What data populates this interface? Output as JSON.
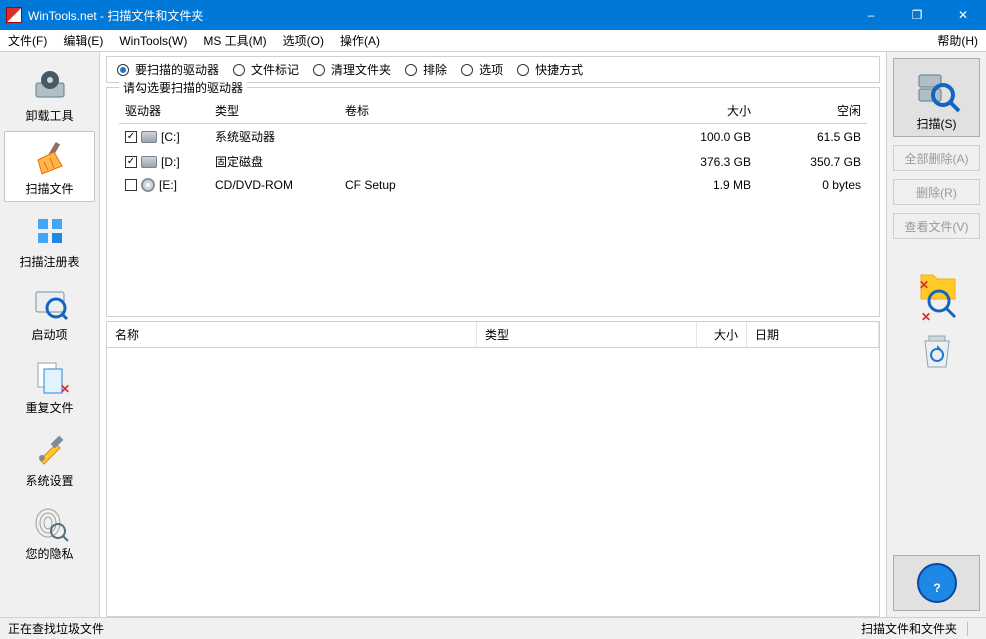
{
  "title": "WinTools.net - 扫描文件和文件夹",
  "window_controls": {
    "minimize": "–",
    "maximize": "❐",
    "close": "✕"
  },
  "menu": {
    "file": "文件(F)",
    "edit": "编辑(E)",
    "wintools": "WinTools(W)",
    "mstools": "MS 工具(M)",
    "options": "选项(O)",
    "actions": "操作(A)",
    "help": "帮助(H)"
  },
  "sidebar": [
    {
      "label": "卸载工具"
    },
    {
      "label": "扫描文件",
      "selected": true
    },
    {
      "label": "扫描注册表"
    },
    {
      "label": "启动项"
    },
    {
      "label": "重复文件"
    },
    {
      "label": "系统设置"
    },
    {
      "label": "您的隐私"
    }
  ],
  "tabs": [
    {
      "label": "要扫描的驱动器",
      "active": true
    },
    {
      "label": "文件标记"
    },
    {
      "label": "清理文件夹"
    },
    {
      "label": "排除"
    },
    {
      "label": "选项"
    },
    {
      "label": "快捷方式"
    }
  ],
  "drives_group": {
    "title": "请勾选要扫描的驱动器",
    "headers": {
      "drive": "驱动器",
      "type": "类型",
      "volume": "卷标",
      "size": "大小",
      "free": "空闲"
    },
    "rows": [
      {
        "checked": true,
        "icon": "hdd",
        "name": "[C:]",
        "type": "系统驱动器",
        "volume": "",
        "size": "100.0 GB",
        "free": "61.5 GB"
      },
      {
        "checked": true,
        "icon": "hdd",
        "name": "[D:]",
        "type": "固定磁盘",
        "volume": "",
        "size": "376.3 GB",
        "free": "350.7 GB"
      },
      {
        "checked": false,
        "icon": "cd",
        "name": "[E:]",
        "type": "CD/DVD-ROM",
        "volume": "CF Setup",
        "size": "1.9 MB",
        "free": "0 bytes"
      }
    ]
  },
  "results": {
    "headers": {
      "name": "名称",
      "type": "类型",
      "size": "大小",
      "date": "日期"
    }
  },
  "right": {
    "scan": "扫描(S)",
    "delete_all": "全部删除(A)",
    "delete": "删除(R)",
    "view_file": "查看文件(V)"
  },
  "status": {
    "left": "正在查找垃圾文件",
    "right": "扫描文件和文件夹"
  }
}
